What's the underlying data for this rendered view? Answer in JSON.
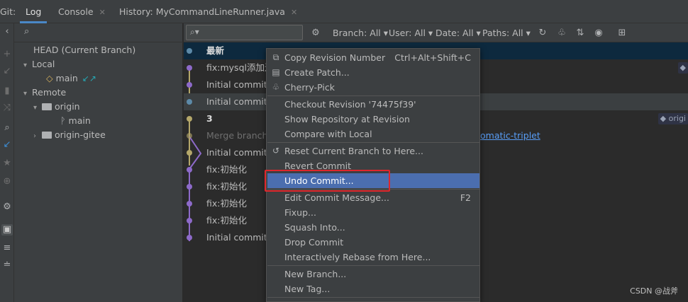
{
  "tabs": {
    "git_label": "Git:",
    "log": "Log",
    "console": "Console",
    "history": "History: MyCommandLineRunner.java"
  },
  "branches": {
    "head": "HEAD (Current Branch)",
    "local": "Local",
    "local_main": "main",
    "remote": "Remote",
    "origin": "origin",
    "origin_main": "main",
    "origin_gitee": "origin-gitee"
  },
  "toolbar": {
    "branch": "Branch: All",
    "user": "User: All",
    "date": "Date: All",
    "paths": "Paths: All"
  },
  "commits": [
    {
      "message": "最新"
    },
    {
      "message": "fix:mysql添加连"
    },
    {
      "message": "Initial commit"
    },
    {
      "message": "Initial commit"
    },
    {
      "message": "3"
    },
    {
      "message": "Merge branch"
    },
    {
      "message": "Initial commit"
    },
    {
      "message": "fix:初始化"
    },
    {
      "message": "fix:初始化"
    },
    {
      "message": "fix:初始化"
    },
    {
      "message": "fix:初始化"
    },
    {
      "message": "Initial commit"
    }
  ],
  "commit_link": "omatic-triplet",
  "ref_label": "origi",
  "menu": {
    "copy_revision": "Copy Revision Number",
    "copy_revision_shortcut": "Ctrl+Alt+Shift+C",
    "create_patch": "Create Patch...",
    "cherry_pick": "Cherry-Pick",
    "checkout_revision": "Checkout Revision '74475f39'",
    "show_repo": "Show Repository at Revision",
    "compare_local": "Compare with Local",
    "reset_branch": "Reset Current Branch to Here...",
    "revert_commit": "Revert Commit",
    "undo_commit": "Undo Commit...",
    "edit_message": "Edit Commit Message...",
    "edit_message_shortcut": "F2",
    "fixup": "Fixup...",
    "squash": "Squash Into...",
    "drop": "Drop Commit",
    "rebase": "Interactively Rebase from Here...",
    "new_branch": "New Branch...",
    "new_tag": "New Tag..."
  },
  "watermark": "CSDN @战斧",
  "colors": {
    "highlight": "#4b6eaf",
    "callout": "#e0262b",
    "graph_purple": "#8d6ac9",
    "graph_olive": "#b4a76a",
    "graph_teal": "#5d8aa8"
  }
}
